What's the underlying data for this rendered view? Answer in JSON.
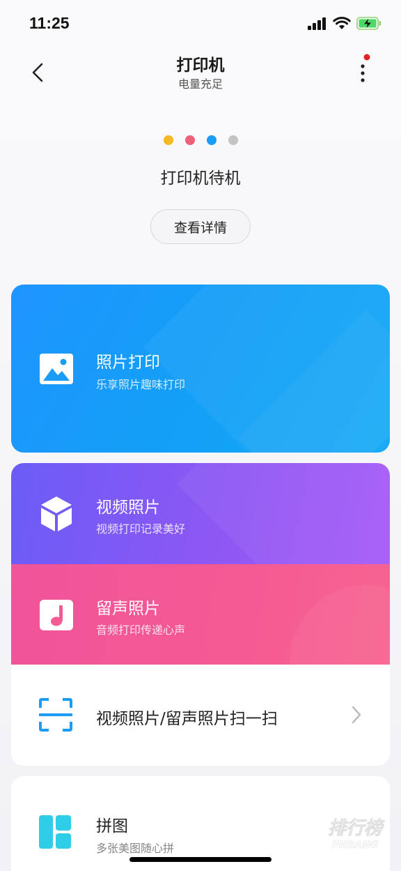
{
  "status_bar": {
    "time": "11:25"
  },
  "nav": {
    "title": "打印机",
    "subtitle": "电量充足"
  },
  "printer": {
    "dot_colors": [
      "#f7b825",
      "#ee6179",
      "#1b9df5",
      "#c4c4c4"
    ],
    "status": "打印机待机",
    "details_button": "查看详情"
  },
  "photo_print": {
    "title": "照片打印",
    "subtitle": "乐享照片趣味打印"
  },
  "video_photo": {
    "title": "视频照片",
    "subtitle": "视频打印记录美好"
  },
  "voice_photo": {
    "title": "留声照片",
    "subtitle": "音频打印传递心声"
  },
  "scan": {
    "label": "视频照片/留声照片扫一扫"
  },
  "puzzle": {
    "title": "拼图",
    "subtitle": "多张美图随心拼"
  },
  "watermark": {
    "text": "排行榜",
    "subtext": "PHBANG"
  },
  "colors": {
    "accent_blue": "#1b9df5",
    "purple": "#8e57f4",
    "pink": "#f45a93",
    "cyan": "#2fcde8",
    "notification_dot": "#e02424"
  }
}
